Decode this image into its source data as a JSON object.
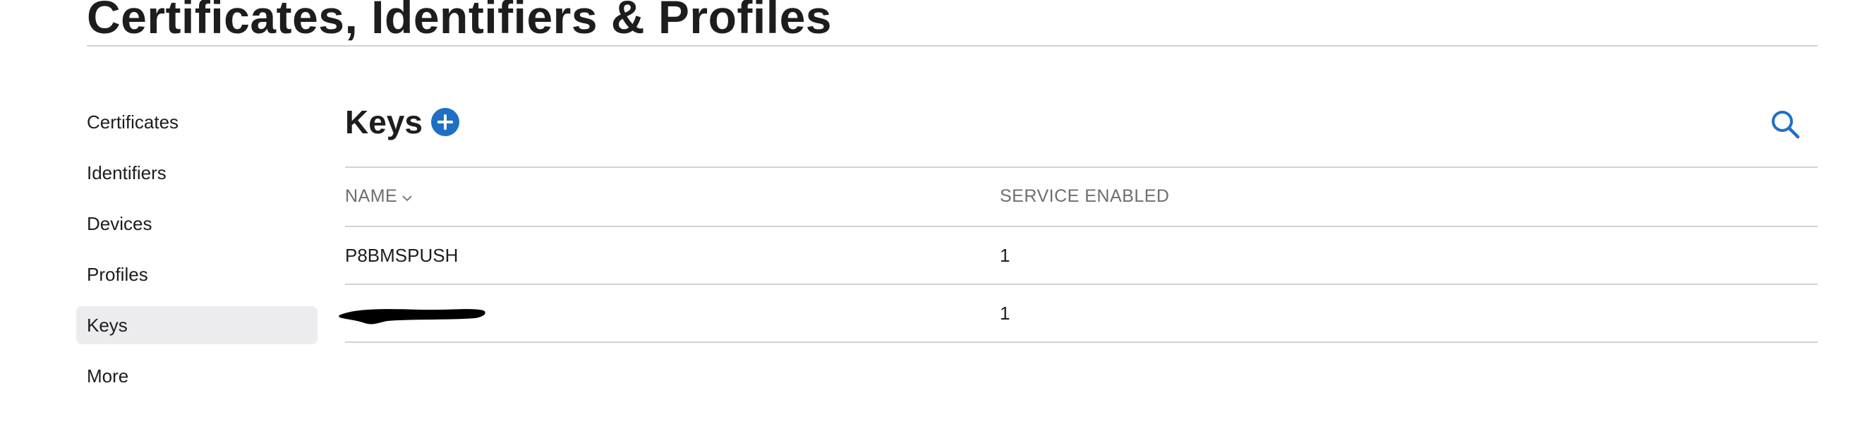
{
  "page": {
    "title": "Certificates, Identifiers & Profiles"
  },
  "sidebar": {
    "items": [
      {
        "label": "Certificates"
      },
      {
        "label": "Identifiers"
      },
      {
        "label": "Devices"
      },
      {
        "label": "Profiles"
      },
      {
        "label": "Keys",
        "active": true
      },
      {
        "label": "More"
      }
    ]
  },
  "main": {
    "section_title": "Keys",
    "add_icon": "plus-circle-icon",
    "search_icon": "search-icon",
    "accent_color": "#1f6fc5",
    "table": {
      "columns": [
        "NAME",
        "SERVICE ENABLED"
      ],
      "sort_icon": "chevron-down-icon",
      "rows": [
        {
          "name": "P8BMSPUSH",
          "service_enabled": "1"
        },
        {
          "name": "",
          "name_redacted": true,
          "service_enabled": "1"
        }
      ]
    }
  }
}
